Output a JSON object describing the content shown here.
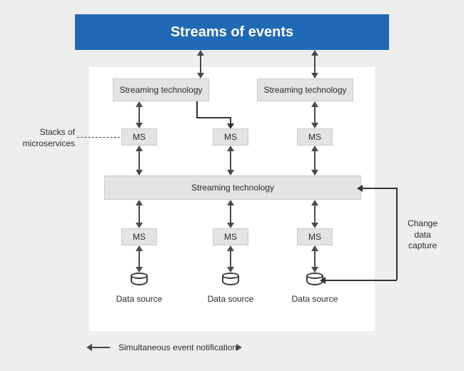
{
  "banner": {
    "title": "Streams of events"
  },
  "tech": {
    "top_left": "Streaming technology",
    "top_right": "Streaming technology",
    "middle": "Streaming technology"
  },
  "ms": {
    "label": "MS",
    "top_a": "MS",
    "top_b": "MS",
    "top_c": "MS",
    "bot_a": "MS",
    "bot_b": "MS",
    "bot_c": "MS"
  },
  "data_source": {
    "a": "Data source",
    "b": "Data source",
    "c": "Data source"
  },
  "annotations": {
    "stacks_line1": "Stacks of",
    "stacks_line2": "microservices",
    "cdc_line1": "Change",
    "cdc_line2": "data",
    "cdc_line3": "capture"
  },
  "legend": {
    "arrow_text": "Simultaneous event notification"
  }
}
